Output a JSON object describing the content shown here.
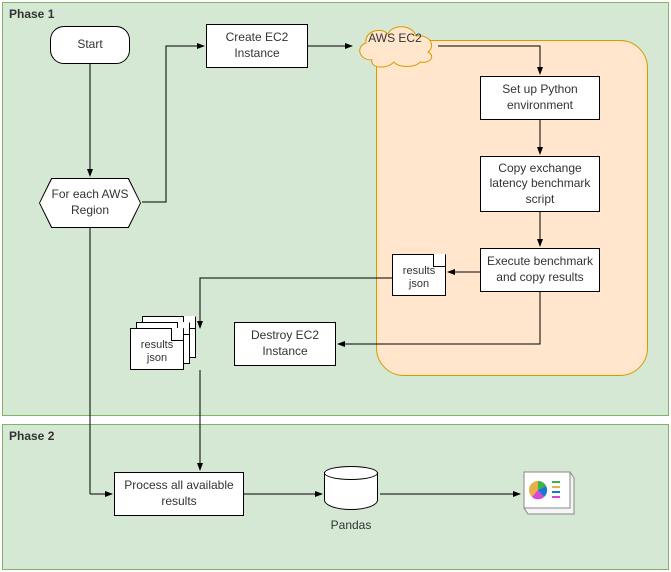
{
  "phase1": {
    "label": "Phase 1"
  },
  "phase2": {
    "label": "Phase 2"
  },
  "nodes": {
    "start": "Start",
    "for_region": "For each AWS Region",
    "create_ec2": "Create EC2 Instance",
    "aws_ec2": "AWS EC2",
    "setup_py": "Set up Python environment",
    "copy_script": "Copy exchange latency benchmark script",
    "exec_bench": "Execute benchmark and copy results",
    "results_single": "results json",
    "results_stack": "results json",
    "destroy_ec2": "Destroy EC2 Instance",
    "process_results": "Process all available results",
    "pandas": "Pandas"
  }
}
